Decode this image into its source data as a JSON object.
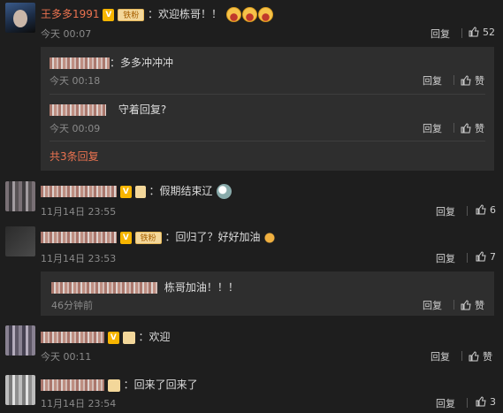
{
  "comments": [
    {
      "username": "王多多1991",
      "text": "：欢迎栋哥！！",
      "time": "今天 00:07",
      "reply_label": "回复",
      "likes": "52",
      "fan_badge": "铁粉",
      "sub": {
        "replies": [
          {
            "text": "：多多冲冲冲",
            "time": "今天 00:18",
            "reply_label": "回复",
            "like_label": "赞"
          },
          {
            "text": "守着回复?",
            "time": "今天 00:09",
            "reply_label": "回复",
            "like_label": "赞"
          }
        ],
        "more_label": "共3条回复"
      }
    },
    {
      "text": "：假期结束辽",
      "time": "11月14日 23:55",
      "reply_label": "回复",
      "likes": "6"
    },
    {
      "text": "：回归了？好好加油",
      "time": "11月14日 23:53",
      "reply_label": "回复",
      "likes": "7",
      "fan_badge": "铁粉",
      "sub": {
        "replies": [
          {
            "text": "栋哥加油！！！",
            "time": "46分钟前",
            "reply_label": "回复",
            "like_label": "赞"
          }
        ]
      }
    },
    {
      "text": "：欢迎",
      "time": "今天 00:11",
      "reply_label": "回复",
      "like_label": "赞"
    },
    {
      "text": "：回来了回来了",
      "time": "11月14日 23:54",
      "reply_label": "回复",
      "likes": "3"
    }
  ],
  "colors": {
    "accent": "#eb7350",
    "background": "#1e1e1e",
    "subbox": "#2e2e2e"
  },
  "icons": [
    "avatar",
    "verified-v-icon",
    "fan-badge-icon",
    "laugh-emoji-icon",
    "thumb-up-icon",
    "muscle-emoji-icon",
    "panda-emoji-icon"
  ]
}
